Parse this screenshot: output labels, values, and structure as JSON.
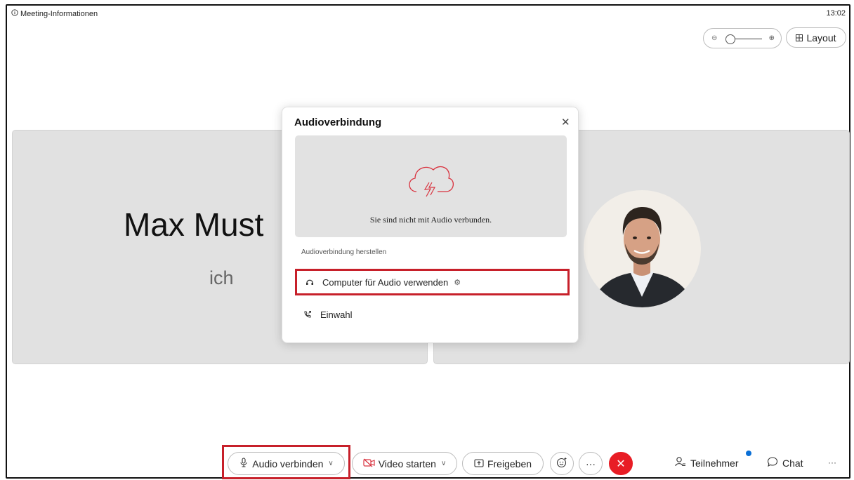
{
  "header": {
    "meeting_info_label": "Meeting-Informationen",
    "clock": "13:02",
    "layout_label": "Layout"
  },
  "tiles": [
    {
      "name": "Max Must",
      "sub": "ich"
    },
    {
      "name": ""
    }
  ],
  "dialog": {
    "title": "Audioverbindung",
    "status_text": "Sie sind nicht mit Audio verbunden.",
    "section_label": "Audioverbindung herstellen",
    "options": [
      {
        "label": "Computer für Audio verwenden",
        "icon": "headset-icon"
      },
      {
        "label": "Einwahl",
        "icon": "phone-icon"
      }
    ]
  },
  "toolbar": {
    "audio_label": "Audio verbinden",
    "video_label": "Video starten",
    "share_label": "Freigeben",
    "participants_label": "Teilnehmer",
    "chat_label": "Chat"
  },
  "colors": {
    "highlight": "#c7202a",
    "leave": "#e81d25",
    "notification": "#0a6fd6",
    "cloud_icon": "#d9333f",
    "tile_bg": "#e1e1e1"
  }
}
